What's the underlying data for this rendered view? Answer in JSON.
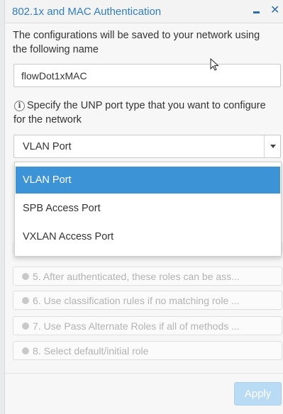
{
  "header": {
    "title": "802.1x and MAC Authentication"
  },
  "description": "The configurations will be saved to your network using the following name",
  "name_input": {
    "value": "flowDot1xMAC"
  },
  "unp": {
    "info_icon": "i",
    "label": "Specify the UNP port type that you want to configure for the network",
    "selected": "VLAN Port",
    "options": [
      "VLAN Port",
      "SPB Access Port",
      "VXLAN Access Port"
    ]
  },
  "steps": [
    "5. After authenticated, these roles can be ass...",
    "6. Use classification rules if no matching role ...",
    "7. Use Pass Alternate Roles if all of methods ...",
    "8. Select default/initial role"
  ],
  "apply_label": "Apply",
  "colors": {
    "accent": "#2f7fc1",
    "selected_option": "#3c93d5",
    "apply_disabled": "#b9dbf3"
  }
}
